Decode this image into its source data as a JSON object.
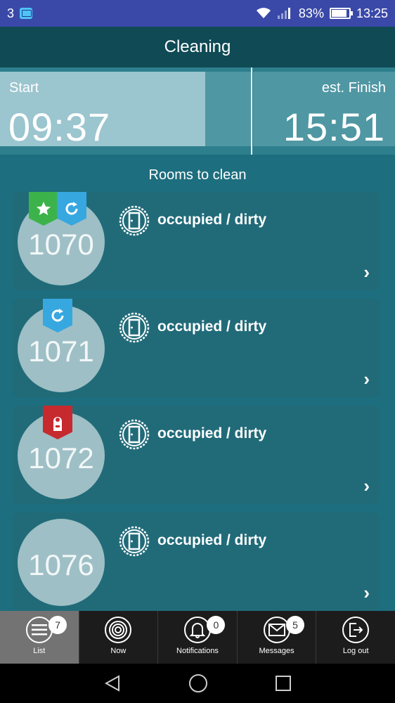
{
  "status_bar": {
    "carrier": "3",
    "battery": "83%",
    "time": "13:25"
  },
  "app": {
    "title": "Cleaning"
  },
  "times": {
    "start_label": "Start",
    "start_time": "09:37",
    "finish_label": "est. Finish",
    "finish_time": "15:51"
  },
  "section_title": "Rooms to clean",
  "rooms": [
    {
      "number": "1070",
      "status": "occupied / dirty",
      "badges": [
        "star-icon",
        "refresh-icon"
      ]
    },
    {
      "number": "1071",
      "status": "occupied / dirty",
      "badges": [
        "refresh-icon"
      ]
    },
    {
      "number": "1072",
      "status": "occupied / dirty",
      "badges": [
        "do-not-disturb-icon"
      ]
    },
    {
      "number": "1076",
      "status": "occupied / dirty",
      "badges": []
    }
  ],
  "tabs": [
    {
      "label": "List",
      "icon": "list-icon",
      "count": "7",
      "active": true
    },
    {
      "label": "Now",
      "icon": "target-icon"
    },
    {
      "label": "Notifications",
      "icon": "bell-icon",
      "count": "0"
    },
    {
      "label": "Messages",
      "icon": "envelope-icon",
      "count": "5"
    },
    {
      "label": "Log out",
      "icon": "logout-icon"
    }
  ],
  "colors": {
    "status_bar": "#3a49a8",
    "app_bar": "#0f4a55",
    "background": "#1d6e7e",
    "badge_green": "#3cb34a",
    "badge_blue": "#37a7e0",
    "badge_red": "#c62a2f"
  }
}
